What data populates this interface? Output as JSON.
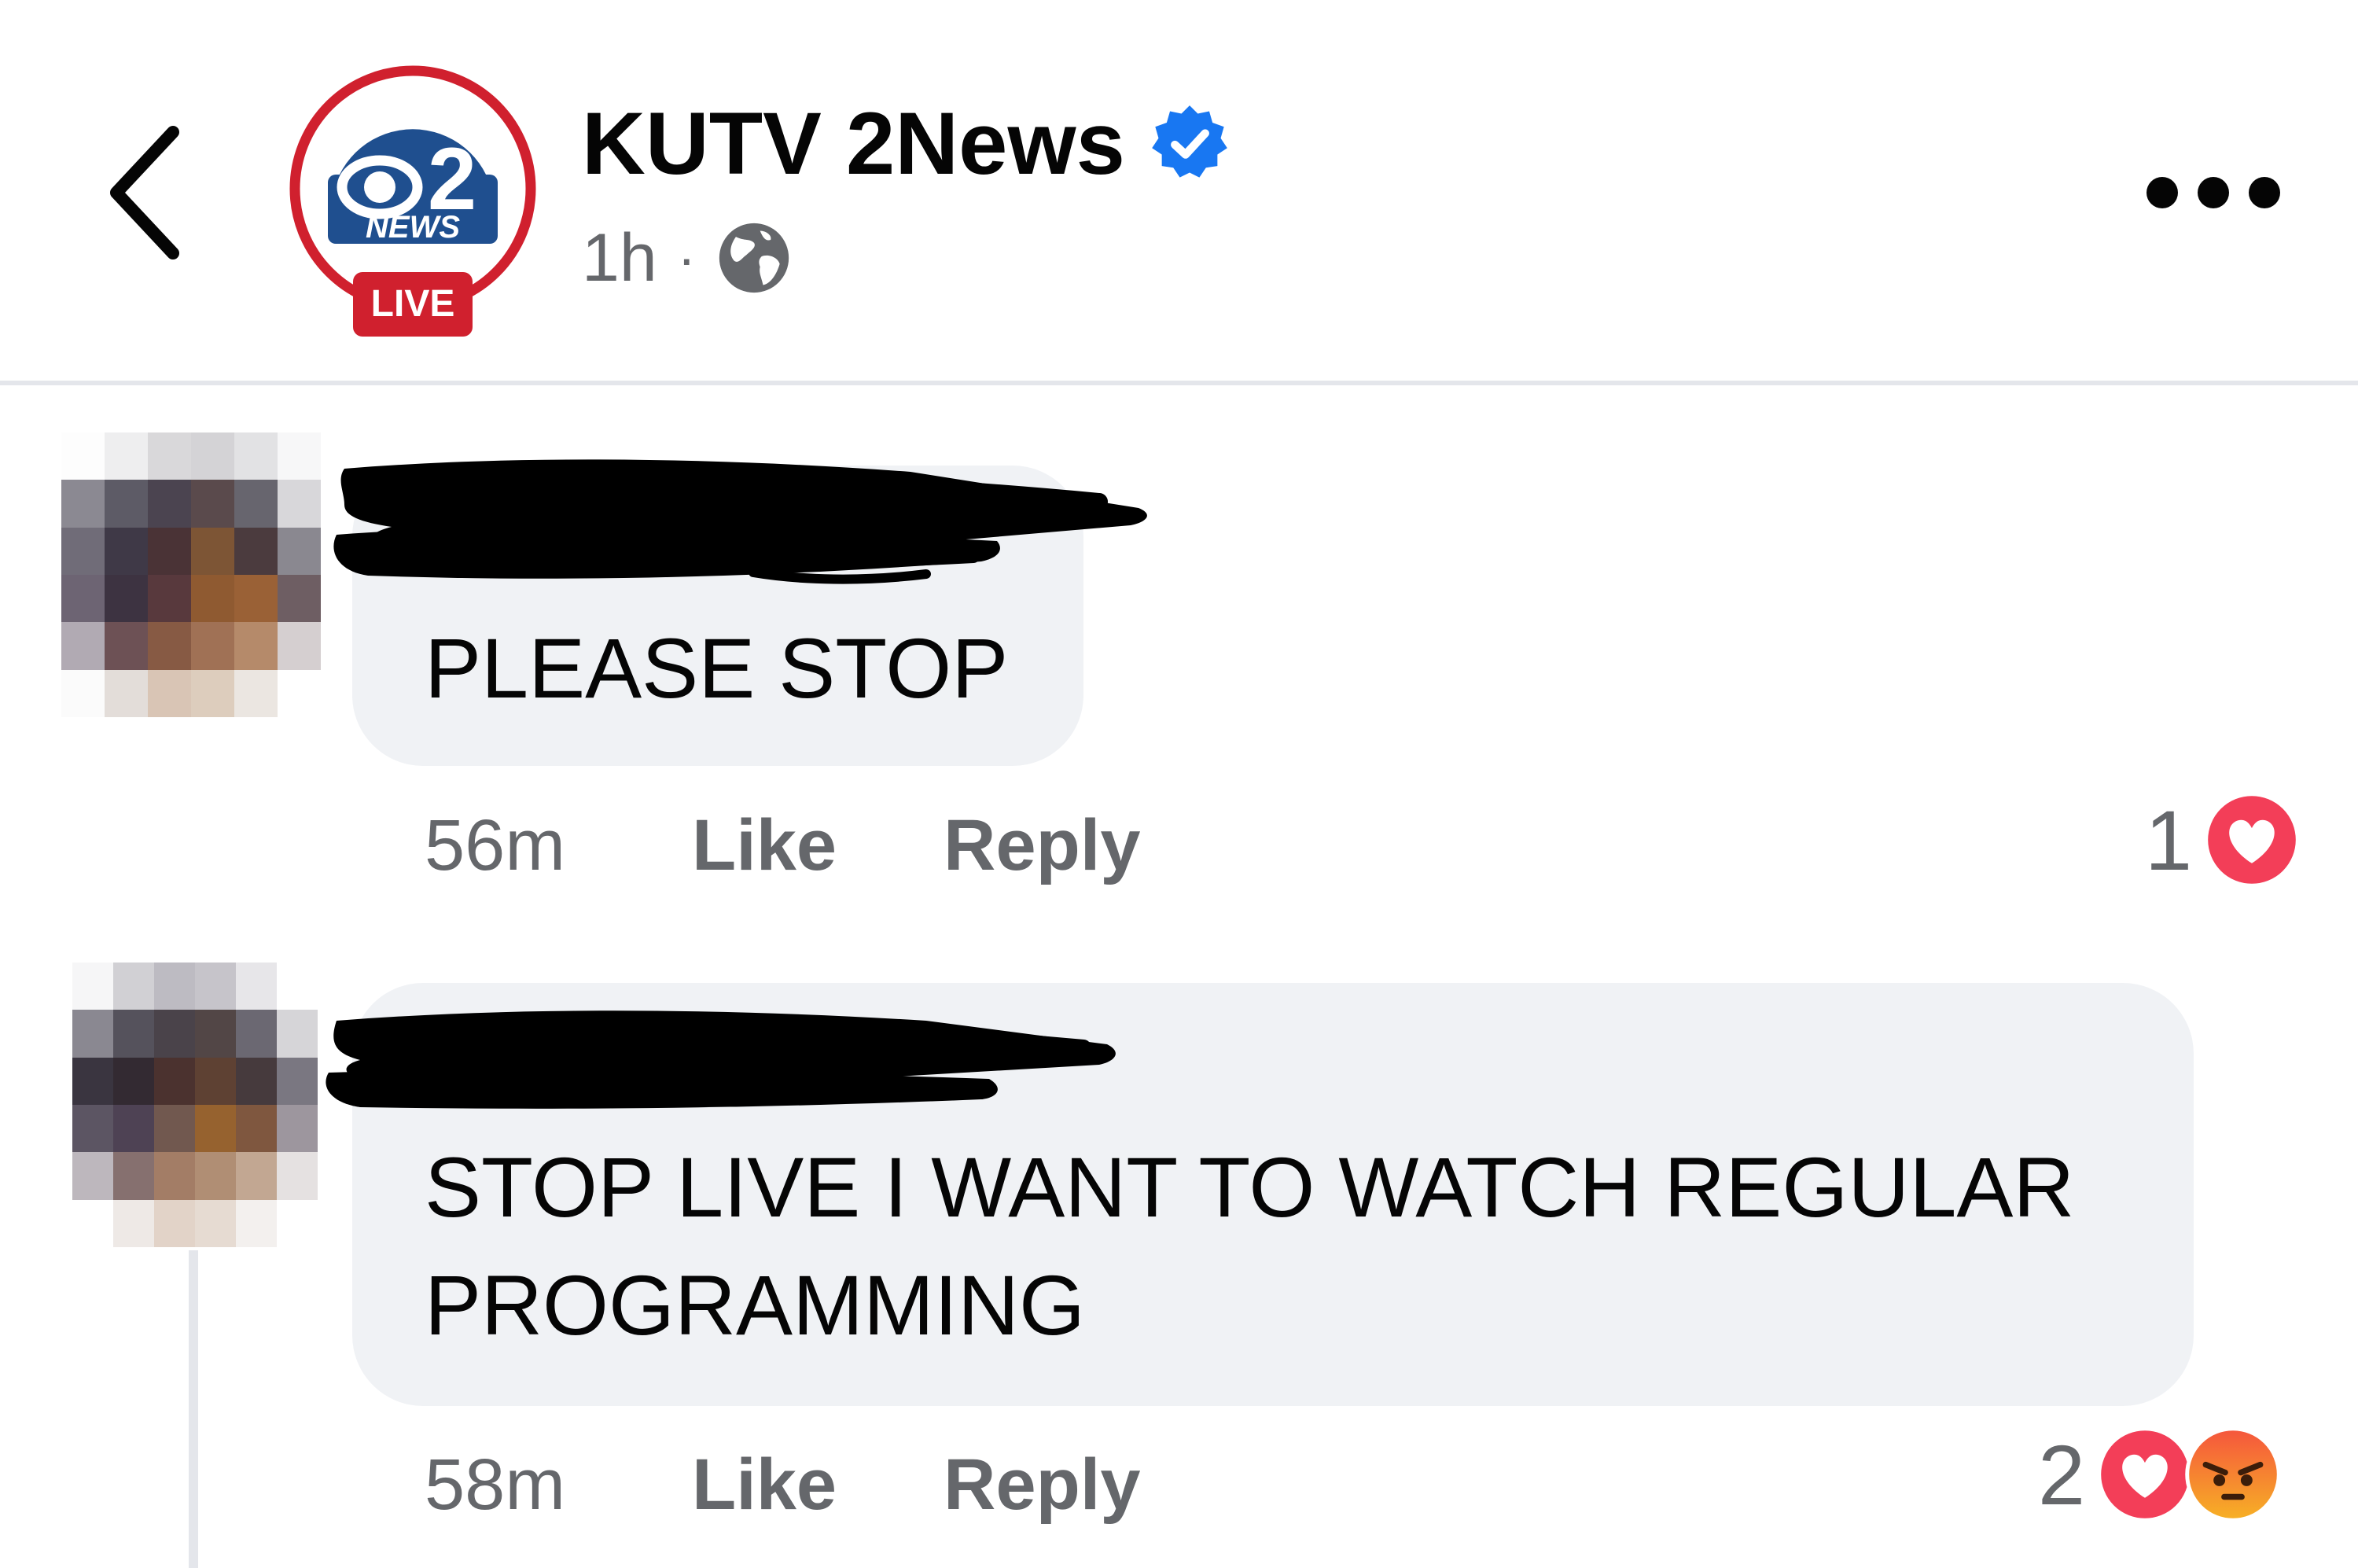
{
  "header": {
    "page_name": "KUTV 2News",
    "time": "1h",
    "separator": "·",
    "avatar": {
      "logo_number": "2",
      "logo_word": "NEWS",
      "badge": "LIVE",
      "ring_color": "#d0202e",
      "disc_color": "#1f4f8f"
    },
    "icons": {
      "back": "chevron-left-icon",
      "verified": "verified-badge-icon",
      "audience": "globe-icon",
      "more": "more-dots-icon"
    }
  },
  "comments": [
    {
      "text": "PLEASE STOP",
      "time": "56m",
      "like_label": "Like",
      "reply_label": "Reply",
      "reaction_count": "1",
      "reactions": [
        "love"
      ]
    },
    {
      "text": "STOP LIVE I WANT TO WATCH REGULAR\nPROGRAMMING",
      "time": "58m",
      "like_label": "Like",
      "reply_label": "Reply",
      "reaction_count": "2",
      "reactions": [
        "love",
        "angry"
      ]
    }
  ],
  "colors": {
    "verified_blue": "#1877f2",
    "love_red": "#f33e58",
    "angry_orange": "#e9710f",
    "bubble_gray": "#f0f2f5",
    "meta_gray": "#65676b"
  }
}
